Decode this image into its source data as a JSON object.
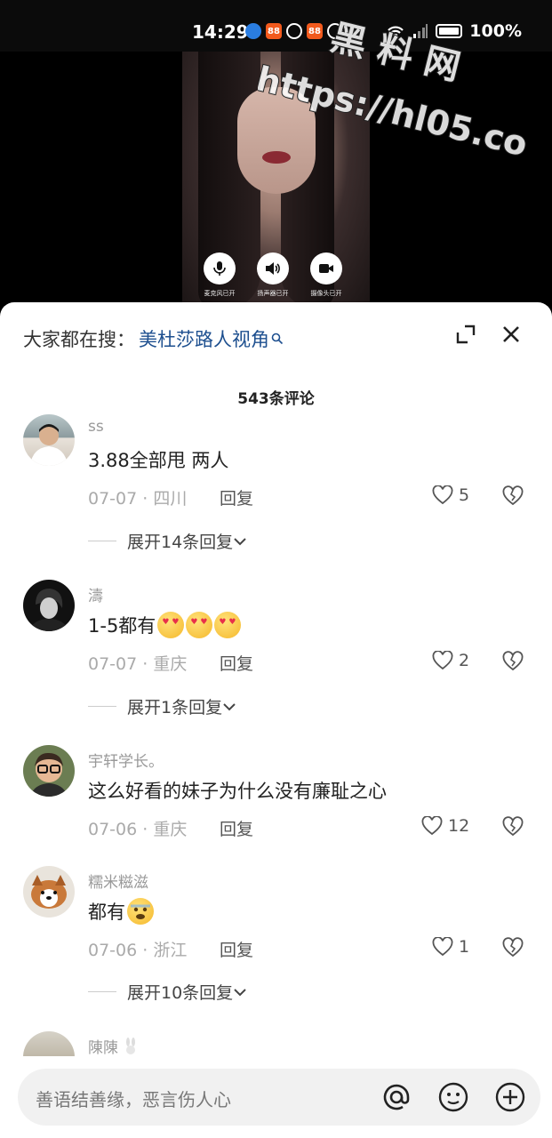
{
  "status_bar": {
    "time": "14:29",
    "battery": "100%",
    "app_badge": "88"
  },
  "call": {
    "controls": [
      {
        "label": "麦克风已开"
      },
      {
        "label": "扬声器已开"
      },
      {
        "label": "摄像头已开"
      }
    ]
  },
  "watermark": {
    "line1": "黑 料 网",
    "line2": "https://hl05.co"
  },
  "search": {
    "prefix": "大家都在搜：",
    "query": "美杜莎路人视角"
  },
  "comment_count": "543条评论",
  "comments": [
    {
      "user": "ss",
      "text": "3.88全部甩 两人",
      "meta": "07-07 · 四川",
      "reply": "回复",
      "likes": "5",
      "expand": "展开14条回复"
    },
    {
      "user": "濤",
      "text": "1-5都有",
      "meta": "07-07 · 重庆",
      "reply": "回复",
      "likes": "2",
      "expand": "展开1条回复"
    },
    {
      "user": "宇轩学长。",
      "text": "这么好看的妹子为什么没有廉耻之心",
      "meta": "07-06 · 重庆",
      "reply": "回复",
      "likes": "12"
    },
    {
      "user": "糯米糍滋",
      "text": "都有",
      "meta": "07-06 · 浙江",
      "reply": "回复",
      "likes": "1",
      "expand": "展开10条回复"
    },
    {
      "user": "陳陳"
    }
  ],
  "input": {
    "placeholder": "善语结善缘，恶言伤人心"
  }
}
